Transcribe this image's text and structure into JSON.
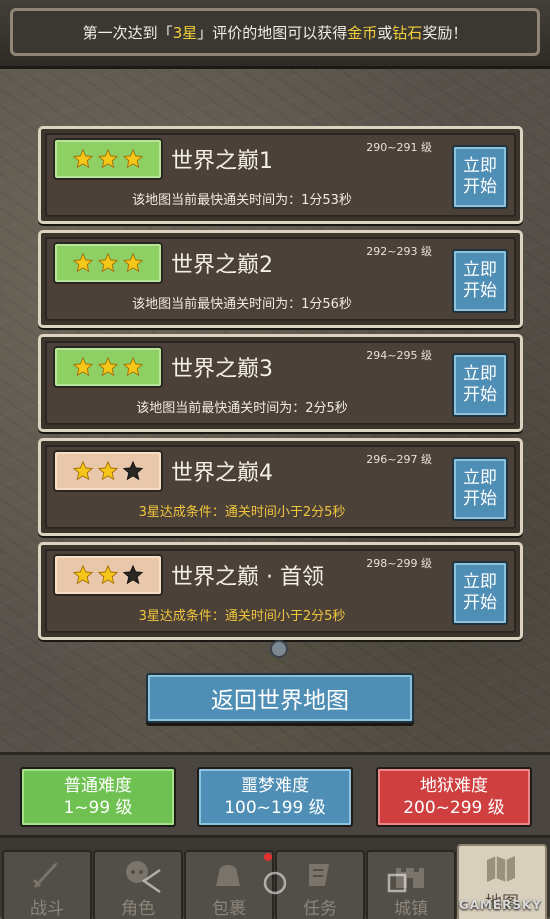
{
  "banner": {
    "prefix": "第一次达到",
    "bracket_open": "「",
    "stars_text": "3星",
    "bracket_close": "」",
    "middle": "评价的地图可以获得",
    "gold": "金币",
    "or": "或",
    "diamond": "钻石",
    "suffix": "奖励！"
  },
  "levels": [
    {
      "title": "世界之巅1",
      "range": "290~291 级",
      "stars": 3,
      "info": "该地图当前最快通关时间为：1分53秒",
      "button": [
        "立即",
        "开始"
      ]
    },
    {
      "title": "世界之巅2",
      "range": "292~293 级",
      "stars": 3,
      "info": "该地图当前最快通关时间为：1分56秒",
      "button": [
        "立即",
        "开始"
      ]
    },
    {
      "title": "世界之巅3",
      "range": "294~295 级",
      "stars": 3,
      "info": "该地图当前最快通关时间为：2分5秒",
      "button": [
        "立即",
        "开始"
      ]
    },
    {
      "title": "世界之巅4",
      "range": "296~297 级",
      "stars": 2,
      "info": "3星达成条件：通关时间小于2分5秒",
      "button": [
        "立即",
        "开始"
      ]
    },
    {
      "title": "世界之巅 · 首领",
      "range": "298~299 级",
      "stars": 2,
      "info": "3星达成条件：通关时间小于2分5秒",
      "button": [
        "立即",
        "开始"
      ]
    }
  ],
  "return_button": "返回世界地图",
  "difficulty": [
    {
      "name": "普通难度",
      "range": "1~99 级"
    },
    {
      "name": "噩梦难度",
      "range": "100~199 级"
    },
    {
      "name": "地狱难度",
      "range": "200~299 级"
    }
  ],
  "nav": [
    {
      "label": "战斗",
      "icon": "sword-icon"
    },
    {
      "label": "角色",
      "icon": "character-icon"
    },
    {
      "label": "包裹",
      "icon": "bag-icon"
    },
    {
      "label": "任务",
      "icon": "quest-icon"
    },
    {
      "label": "城镇",
      "icon": "castle-icon"
    },
    {
      "label": "地图",
      "icon": "map-icon"
    }
  ],
  "active_nav": "地图",
  "watermark": "GAMERSKY",
  "colors": {
    "star_gold": "#f5c518",
    "star_empty": "#2b2723",
    "accent_blue": "#4f8fb5",
    "normal_green": "#6fc252",
    "hell_red": "#cf3f3f",
    "highlight_yellow": "#f1cf3a"
  }
}
